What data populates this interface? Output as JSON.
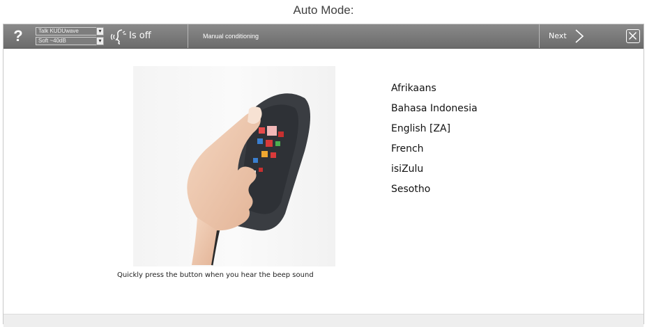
{
  "caption": "Auto Mode:",
  "toolbar": {
    "help_label": "?",
    "output_select": "Talk KUDUwave",
    "level_select": "Soft ~40dB",
    "speaker_status": "Is off",
    "mode_title": "Manual conditioning",
    "next_label": "Next",
    "icons": {
      "help": "question-mark-icon",
      "speaker": "sound-waves-icon",
      "next": "chevron-right-icon",
      "close": "close-icon"
    }
  },
  "main": {
    "instruction": "Quickly press the button when you hear the beep sound",
    "languages": [
      "Afrikaans",
      "Bahasa Indonesia",
      "English [ZA]",
      "French",
      "isiZulu",
      "Sesotho"
    ]
  },
  "colors": {
    "toolbar_top": "#8a8a8a",
    "toolbar_bottom": "#6b6b6b",
    "background": "#ffffff"
  }
}
